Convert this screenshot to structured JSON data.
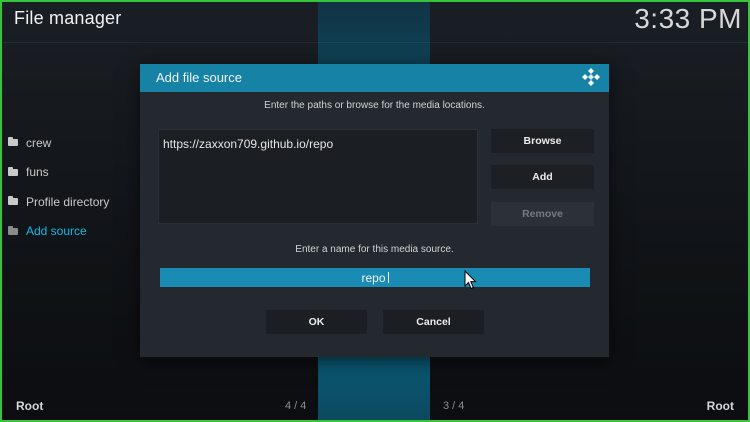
{
  "app": {
    "title": "File manager",
    "clock": "3:33 PM"
  },
  "sidebar": {
    "items": [
      {
        "label": "crew",
        "icon": "folder-icon"
      },
      {
        "label": "funs",
        "icon": "folder-icon"
      },
      {
        "label": "Profile directory",
        "icon": "folder-icon"
      },
      {
        "label": "Add source",
        "icon": "folder-icon",
        "active": true
      }
    ]
  },
  "dialog": {
    "title": "Add file source",
    "instruction_paths": "Enter the paths or browse for the media locations.",
    "paths": [
      "https://zaxxon709.github.io/repo"
    ],
    "buttons": {
      "browse": "Browse",
      "add": "Add",
      "remove": "Remove"
    },
    "instruction_name": "Enter a name for this media source.",
    "name_value": "repo",
    "ok_label": "OK",
    "cancel_label": "Cancel"
  },
  "statusbar": {
    "left": "Root",
    "right": "Root",
    "page_left": "4 / 4",
    "page_right": "3 / 4"
  },
  "colors": {
    "accent": "#1582a6",
    "input_highlight": "#1a8bb3",
    "active_item": "#19b8e6",
    "frame": "#36c43c"
  }
}
